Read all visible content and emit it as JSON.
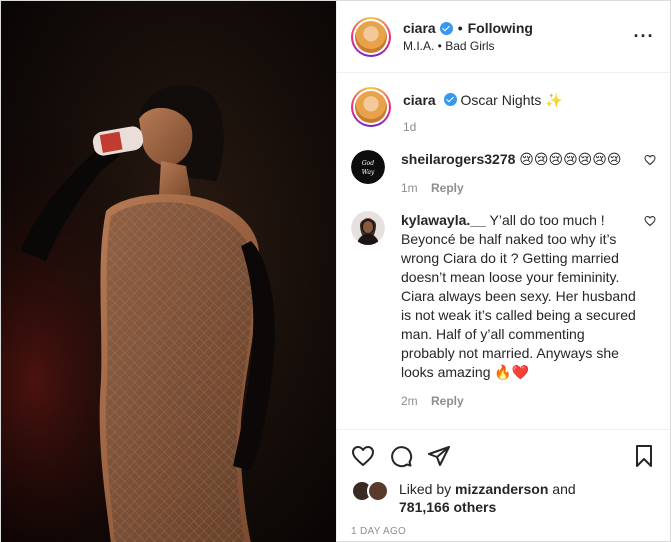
{
  "post": {
    "author": "ciara",
    "follow_state": "Following",
    "location": "M.I.A. • Bad Girls",
    "more_icon": "more-horizontal-icon"
  },
  "caption": {
    "username": "ciara",
    "text": "Oscar Nights ✨",
    "age": "1d"
  },
  "comments": [
    {
      "username": "sheilarogers3278",
      "text": "😢😢😢😢😢😢😢",
      "age": "1m",
      "reply": "Reply"
    },
    {
      "username": "kylawayla.__",
      "text": "Y’all do too much ! Beyoncé be half naked too why it’s wrong Ciara do it ? Getting married doesn’t mean loose your femininity. Ciara always been sexy. Her husband is not weak it’s called being a secured man. Half of y’all commenting probably not married. Anyways she looks amazing 🔥❤️",
      "age": "2m",
      "reply": "Reply"
    }
  ],
  "likes": {
    "prefix": "Liked by",
    "user": "mizzanderson",
    "and": "and",
    "others": "781,166 others"
  },
  "timestamp": "1 DAY AGO",
  "colors": {
    "verified": "#3897f0",
    "meta_gray": "#8e8e8e",
    "text": "#262626"
  }
}
